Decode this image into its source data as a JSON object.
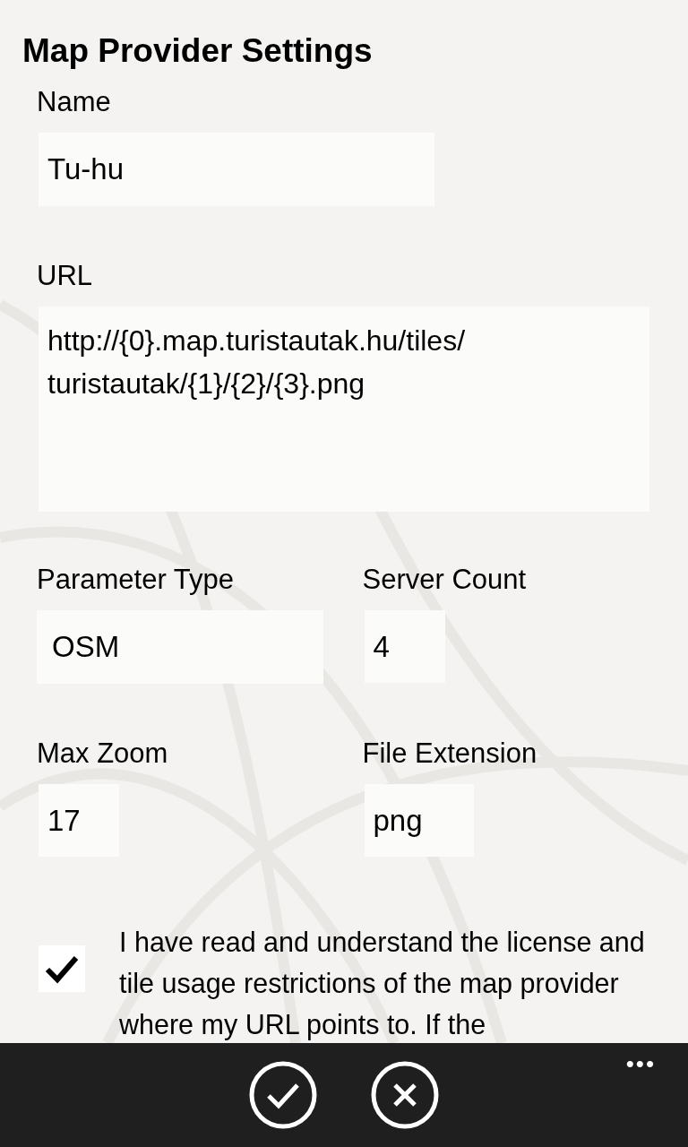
{
  "title": "Map Provider Settings",
  "fields": [
    {
      "label": "Name",
      "value": "Tu-hu"
    },
    {
      "label": "URL",
      "value": "http://{0}.map.turistautak.hu/tiles/\nturistautak/{1}/{2}/{3}.png"
    }
  ],
  "pairs": [
    [
      {
        "label": "Parameter Type",
        "value": "OSM",
        "kind": "dropdown"
      },
      {
        "label": "Server Count",
        "value": "4",
        "kind": "text"
      }
    ],
    [
      {
        "label": "Max Zoom",
        "value": "17",
        "kind": "text"
      },
      {
        "label": "File Extension",
        "value": "png",
        "kind": "text"
      }
    ]
  ],
  "license": {
    "checked": true,
    "text": "I have read and understand the license and tile usage restrictions of the map provider where my URL points to. If the"
  },
  "app_bar": {
    "buttons": [
      {
        "kind": "save"
      },
      {
        "kind": "cancel"
      }
    ],
    "more": "•••"
  }
}
